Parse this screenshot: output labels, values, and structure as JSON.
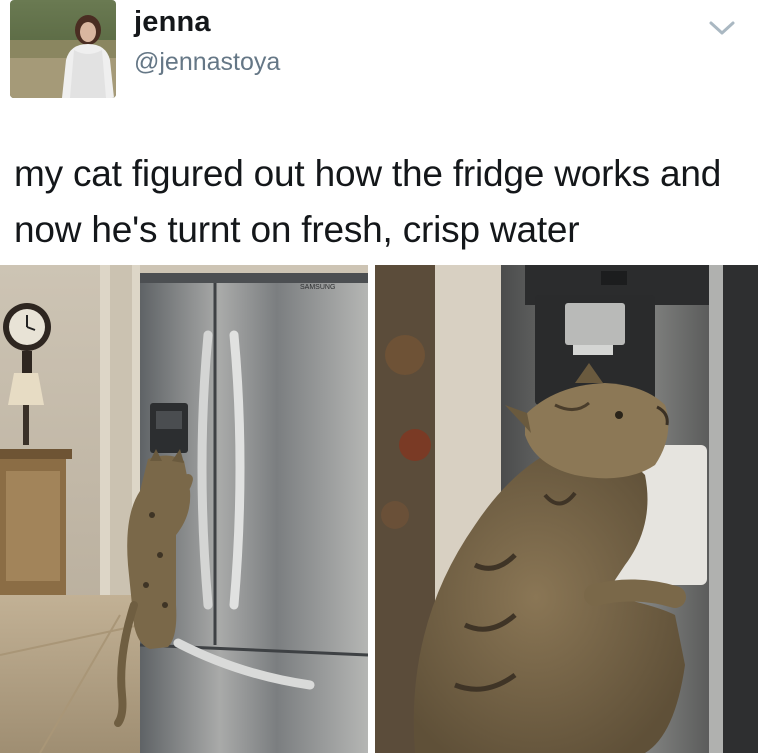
{
  "tweet": {
    "display_name": "jenna",
    "handle": "@jennastoya",
    "text": "my cat figured out how the fridge works and now he's turnt on fresh, crisp water",
    "menu_icon": "chevron-down-icon"
  },
  "photos": {
    "left": {
      "fridge_brand": "SAMSUNG"
    },
    "colors": {
      "wall": "#cfc5b4",
      "fridge_steel": "#8e8f8e",
      "cat_fur": "#7d6a4c",
      "floor": "#b9a78b"
    }
  }
}
